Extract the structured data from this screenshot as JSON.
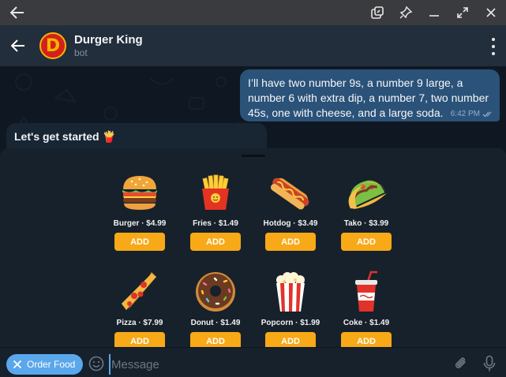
{
  "chat": {
    "title": "Durger King",
    "subtitle": "bot",
    "avatar_letter": "D"
  },
  "messages": {
    "outgoing_text": "I’ll have two number 9s, a number 9 large, a number 6 with extra dip, a number 7, two number 45s, one with cheese, and a large soda.",
    "outgoing_time": "6:42 PM",
    "incoming_text": "Let's get started 🍟"
  },
  "menu": {
    "items": [
      {
        "caption": "Burger · $4.99",
        "icon": "burger-icon",
        "add_label": "ADD"
      },
      {
        "caption": "Fries · $1.49",
        "icon": "fries-icon",
        "add_label": "ADD"
      },
      {
        "caption": "Hotdog · $3.49",
        "icon": "hotdog-icon",
        "add_label": "ADD"
      },
      {
        "caption": "Tako · $3.99",
        "icon": "taco-icon",
        "add_label": "ADD"
      },
      {
        "caption": "Pizza · $7.99",
        "icon": "pizza-icon",
        "add_label": "ADD"
      },
      {
        "caption": "Donut · $1.49",
        "icon": "donut-icon",
        "add_label": "ADD"
      },
      {
        "caption": "Popcorn · $1.99",
        "icon": "popcorn-icon",
        "add_label": "ADD"
      },
      {
        "caption": "Coke · $1.49",
        "icon": "soda-icon",
        "add_label": "ADD"
      }
    ]
  },
  "composer": {
    "order_button_label": "Order Food",
    "placeholder": "Message"
  },
  "colors": {
    "accent": "#5aa7ec",
    "add_button": "#f8a917",
    "outgoing_bubble": "#2b5278",
    "panel_bg": "#17212b"
  }
}
